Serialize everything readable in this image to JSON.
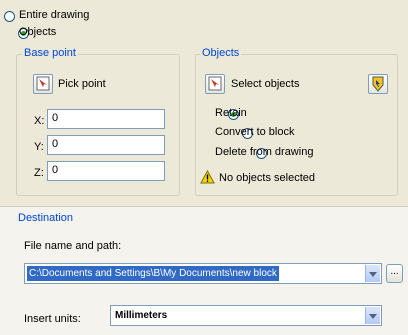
{
  "source": {
    "entire_drawing_label": "Entire drawing",
    "objects_label": "Objects",
    "selected": "objects"
  },
  "base_point": {
    "title": "Base point",
    "pick_label": "Pick point",
    "x_label": "X:",
    "y_label": "Y:",
    "z_label": "Z:",
    "x_value": "0",
    "y_value": "0",
    "z_value": "0"
  },
  "objects": {
    "title": "Objects",
    "select_label": "Select objects",
    "retain_label": "Retain",
    "convert_label": "Convert to block",
    "delete_label": "Delete from drawing",
    "warning_text": "No objects selected",
    "selected": "retain"
  },
  "destination": {
    "title": "Destination",
    "file_label": "File name and path:",
    "file_value": "C:\\Documents and Settings\\B\\My Documents\\new block",
    "browse_label": "...",
    "units_label": "Insert units:",
    "units_value": "Millimeters"
  },
  "colors": {
    "group_title": "#0046d5",
    "selection_bg": "#316ac5",
    "panel_bg": "#ece9d8"
  }
}
